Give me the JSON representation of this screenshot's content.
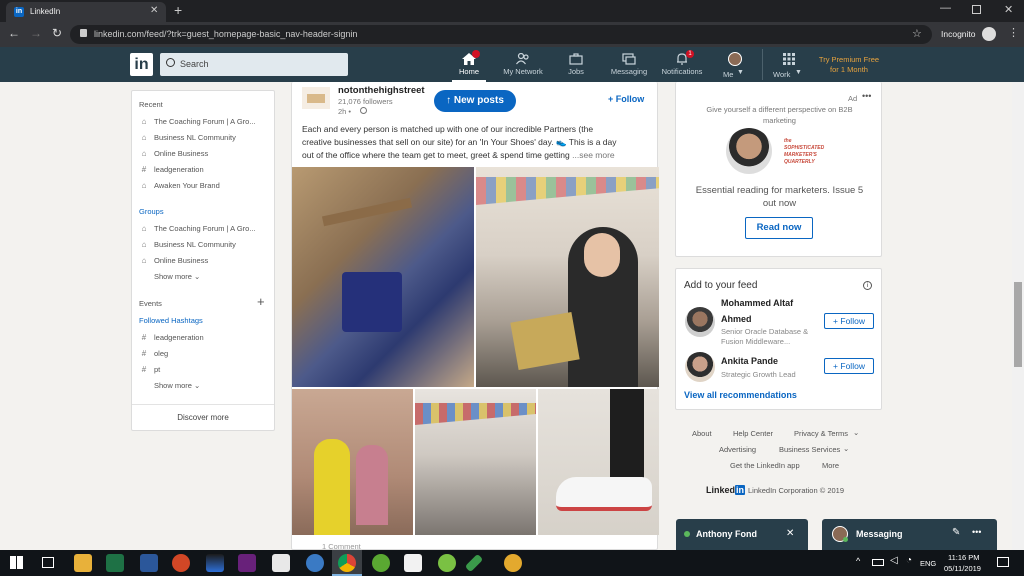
{
  "browser": {
    "tab_title": "LinkedIn",
    "url": "linkedin.com/feed/?trk=guest_homepage-basic_nav-header-signin",
    "profile_label": "Incognito"
  },
  "nav": {
    "logo": "in",
    "search_placeholder": "Search",
    "items": [
      {
        "label": "Home",
        "badge": ""
      },
      {
        "label": "My Network",
        "badge": ""
      },
      {
        "label": "Jobs",
        "badge": ""
      },
      {
        "label": "Messaging",
        "badge": ""
      },
      {
        "label": "Notifications",
        "badge": "1"
      },
      {
        "label": "Me",
        "badge": ""
      },
      {
        "label": "Work",
        "badge": ""
      }
    ],
    "premium_line1": "Try Premium Free",
    "premium_line2": "for 1 Month"
  },
  "left_sidebar": {
    "recent_title": "Recent",
    "recent": [
      {
        "icon": "group-icon",
        "label": "The Coaching Forum | A Gro..."
      },
      {
        "icon": "group-icon",
        "label": "Business NL Community"
      },
      {
        "icon": "group-icon",
        "label": "Online Business"
      },
      {
        "icon": "hashtag-icon",
        "label": "leadgeneration"
      },
      {
        "icon": "group-icon",
        "label": "Awaken Your Brand"
      }
    ],
    "groups_title": "Groups",
    "groups": [
      {
        "label": "The Coaching Forum | A Gro..."
      },
      {
        "label": "Business NL Community"
      },
      {
        "label": "Online Business"
      }
    ],
    "show_more": "Show more",
    "events_title": "Events",
    "hashtags_title": "Followed Hashtags",
    "hashtags": [
      "leadgeneration",
      "oleg",
      "pt"
    ],
    "discover_more": "Discover more"
  },
  "post": {
    "author": "notonthehighstreet",
    "followers": "21,076 followers",
    "time": "2h •",
    "follow_label": "Follow",
    "new_posts_label": "New posts",
    "text_line1": "Each and every person is matched up with one of our incredible Partners (the",
    "text_line2": "creative businesses that sell on our site) for an 'In Your Shoes' day. 👟 This is a day",
    "text_line3": "out of the office where the team get to meet, greet & spend time getting",
    "see_more": "...see more",
    "reactions": "1 Comment"
  },
  "ad": {
    "ad_label": "Ad",
    "tagline_line1": "Give yourself a different perspective on B2B",
    "tagline_line2": "marketing",
    "brand_logo_text": "the SOPHISTICATED MARKETER'S QUARTERLY",
    "headline_line1": "Essential reading for marketers. Issue 5",
    "headline_line2": "out now",
    "cta": "Read now"
  },
  "feed_suggestions": {
    "title": "Add to your feed",
    "people": [
      {
        "name_line1": "Mohammed Altaf",
        "name_line2": "Ahmed",
        "desc_line1": "Senior Oracle Database &",
        "desc_line2": "Fusion Middleware...",
        "follow": "Follow"
      },
      {
        "name_line1": "Ankita Pande",
        "name_line2": "",
        "desc_line1": "Strategic Growth Lead",
        "desc_line2": "",
        "follow": "Follow"
      }
    ],
    "view_all": "View all recommendations"
  },
  "footer": {
    "links_row1": [
      "About",
      "Help Center",
      "Privacy & Terms"
    ],
    "links_row2": [
      "Advertising",
      "Business Services"
    ],
    "links_row3": [
      "Get the LinkedIn app",
      "More"
    ],
    "brand": "Linked",
    "copyright": "LinkedIn Corporation © 2019"
  },
  "chat": {
    "conversation_name": "Anthony Fond",
    "messaging_label": "Messaging"
  },
  "taskbar": {
    "lang": "ENG",
    "time": "11:16 PM",
    "date": "05/11/2019"
  }
}
